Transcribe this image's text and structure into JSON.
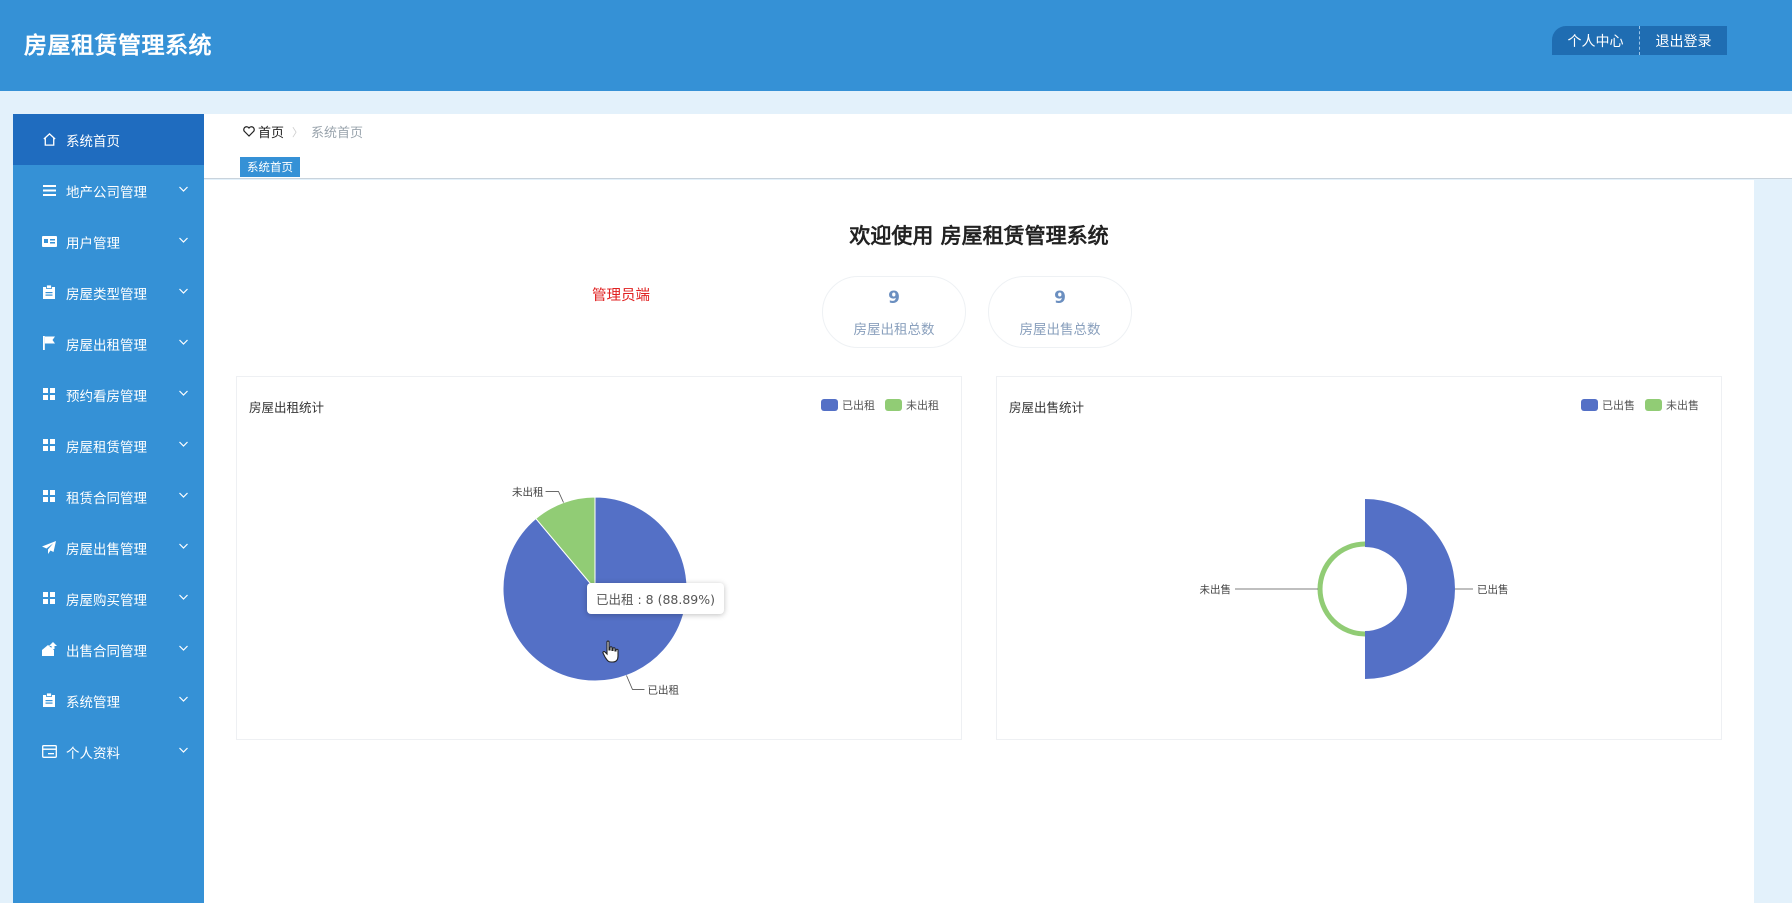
{
  "header": {
    "title": "房屋租赁管理系统",
    "profile_label": "个人中心",
    "logout_label": "退出登录"
  },
  "sidebar": {
    "items": [
      {
        "label": "系统首页",
        "icon": "home-icon",
        "active": true,
        "has_children": false
      },
      {
        "label": "地产公司管理",
        "icon": "list-icon",
        "has_children": true
      },
      {
        "label": "用户管理",
        "icon": "id-card-icon",
        "has_children": true
      },
      {
        "label": "房屋类型管理",
        "icon": "clipboard-icon",
        "has_children": true
      },
      {
        "label": "房屋出租管理",
        "icon": "flag-icon",
        "has_children": true
      },
      {
        "label": "预约看房管理",
        "icon": "grid-icon",
        "has_children": true
      },
      {
        "label": "房屋租赁管理",
        "icon": "grid-icon",
        "has_children": true
      },
      {
        "label": "租赁合同管理",
        "icon": "grid-icon",
        "has_children": true
      },
      {
        "label": "房屋出售管理",
        "icon": "paper-plane-icon",
        "has_children": true
      },
      {
        "label": "房屋购买管理",
        "icon": "grid-icon",
        "has_children": true
      },
      {
        "label": "出售合同管理",
        "icon": "house-upload-icon",
        "has_children": true
      },
      {
        "label": "系统管理",
        "icon": "clipboard-icon",
        "has_children": true
      },
      {
        "label": "个人资料",
        "icon": "card-icon",
        "has_children": true
      }
    ]
  },
  "breadcrumb": {
    "home": "首页",
    "current": "系统首页"
  },
  "tabs": [
    {
      "label": "系统首页"
    }
  ],
  "main": {
    "welcome": "欢迎使用 房屋租赁管理系统",
    "role": "管理员端",
    "stats": [
      {
        "value": "9",
        "label": "房屋出租总数"
      },
      {
        "value": "9",
        "label": "房屋出售总数"
      }
    ]
  },
  "colors": {
    "primary": "#3591d6",
    "sidebar_active": "#1f6cbf",
    "series_blue": "#5470c6",
    "series_green": "#91cc75",
    "role_red": "#e02020"
  },
  "chart_data": [
    {
      "type": "pie",
      "title": "房屋出租统计",
      "legend_position": "top-right",
      "series": [
        {
          "name": "已出租",
          "value": 8
        },
        {
          "name": "未出租",
          "value": 1
        }
      ],
      "tooltip": "已出租 : 8 (88.89%)"
    },
    {
      "type": "pie",
      "title": "房屋出售统计",
      "legend_position": "top-right",
      "series": [
        {
          "name": "已出售",
          "value": 9
        },
        {
          "name": "未出售",
          "value": 0
        }
      ]
    }
  ]
}
